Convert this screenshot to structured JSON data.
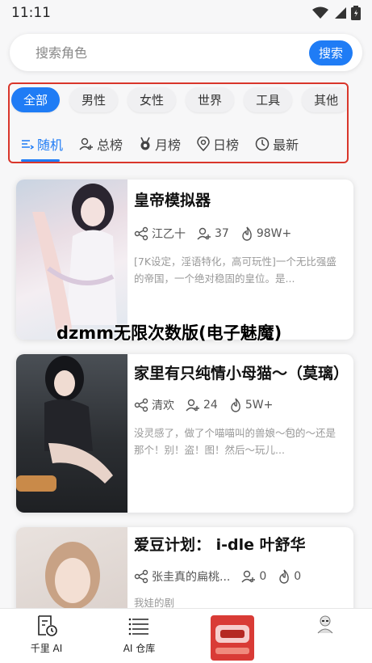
{
  "status_bar": {
    "time": "11:11"
  },
  "search": {
    "placeholder": "搜索角色",
    "button_label": "搜索"
  },
  "categories": [
    "全部",
    "男性",
    "女性",
    "世界",
    "工具",
    "其他"
  ],
  "sort_tabs": [
    "随机",
    "总榜",
    "月榜",
    "日榜",
    "最新"
  ],
  "cards": [
    {
      "title": "皇帝模拟器",
      "author": "江乙十",
      "users": "37",
      "heat": "98W+",
      "desc": "[7K设定，淫语特化，高可玩性]一个无比强盛的帝国，一个绝对稳固的皇位。是..."
    },
    {
      "title": "家里有只纯情小母猫～（莫璃）",
      "author": "清欢",
      "users": "24",
      "heat": "5W+",
      "desc": "没灵感了，做了个喵喵叫的兽娘～包⃝的～还是那个！别！盗！图！然后～玩儿..."
    },
    {
      "title": "爱豆计划： i-dle 叶舒华",
      "author": "张圭真的扁桃...",
      "users": "0",
      "heat": "0",
      "desc": "我娃的剧"
    }
  ],
  "watermark": "dzmm无限次数版(电子魅魔)",
  "bottom_nav": {
    "item1": "千里 AI",
    "item2": "AI 仓库"
  },
  "colors": {
    "accent": "#1f7cf5",
    "highlight_border": "#d9362b"
  }
}
